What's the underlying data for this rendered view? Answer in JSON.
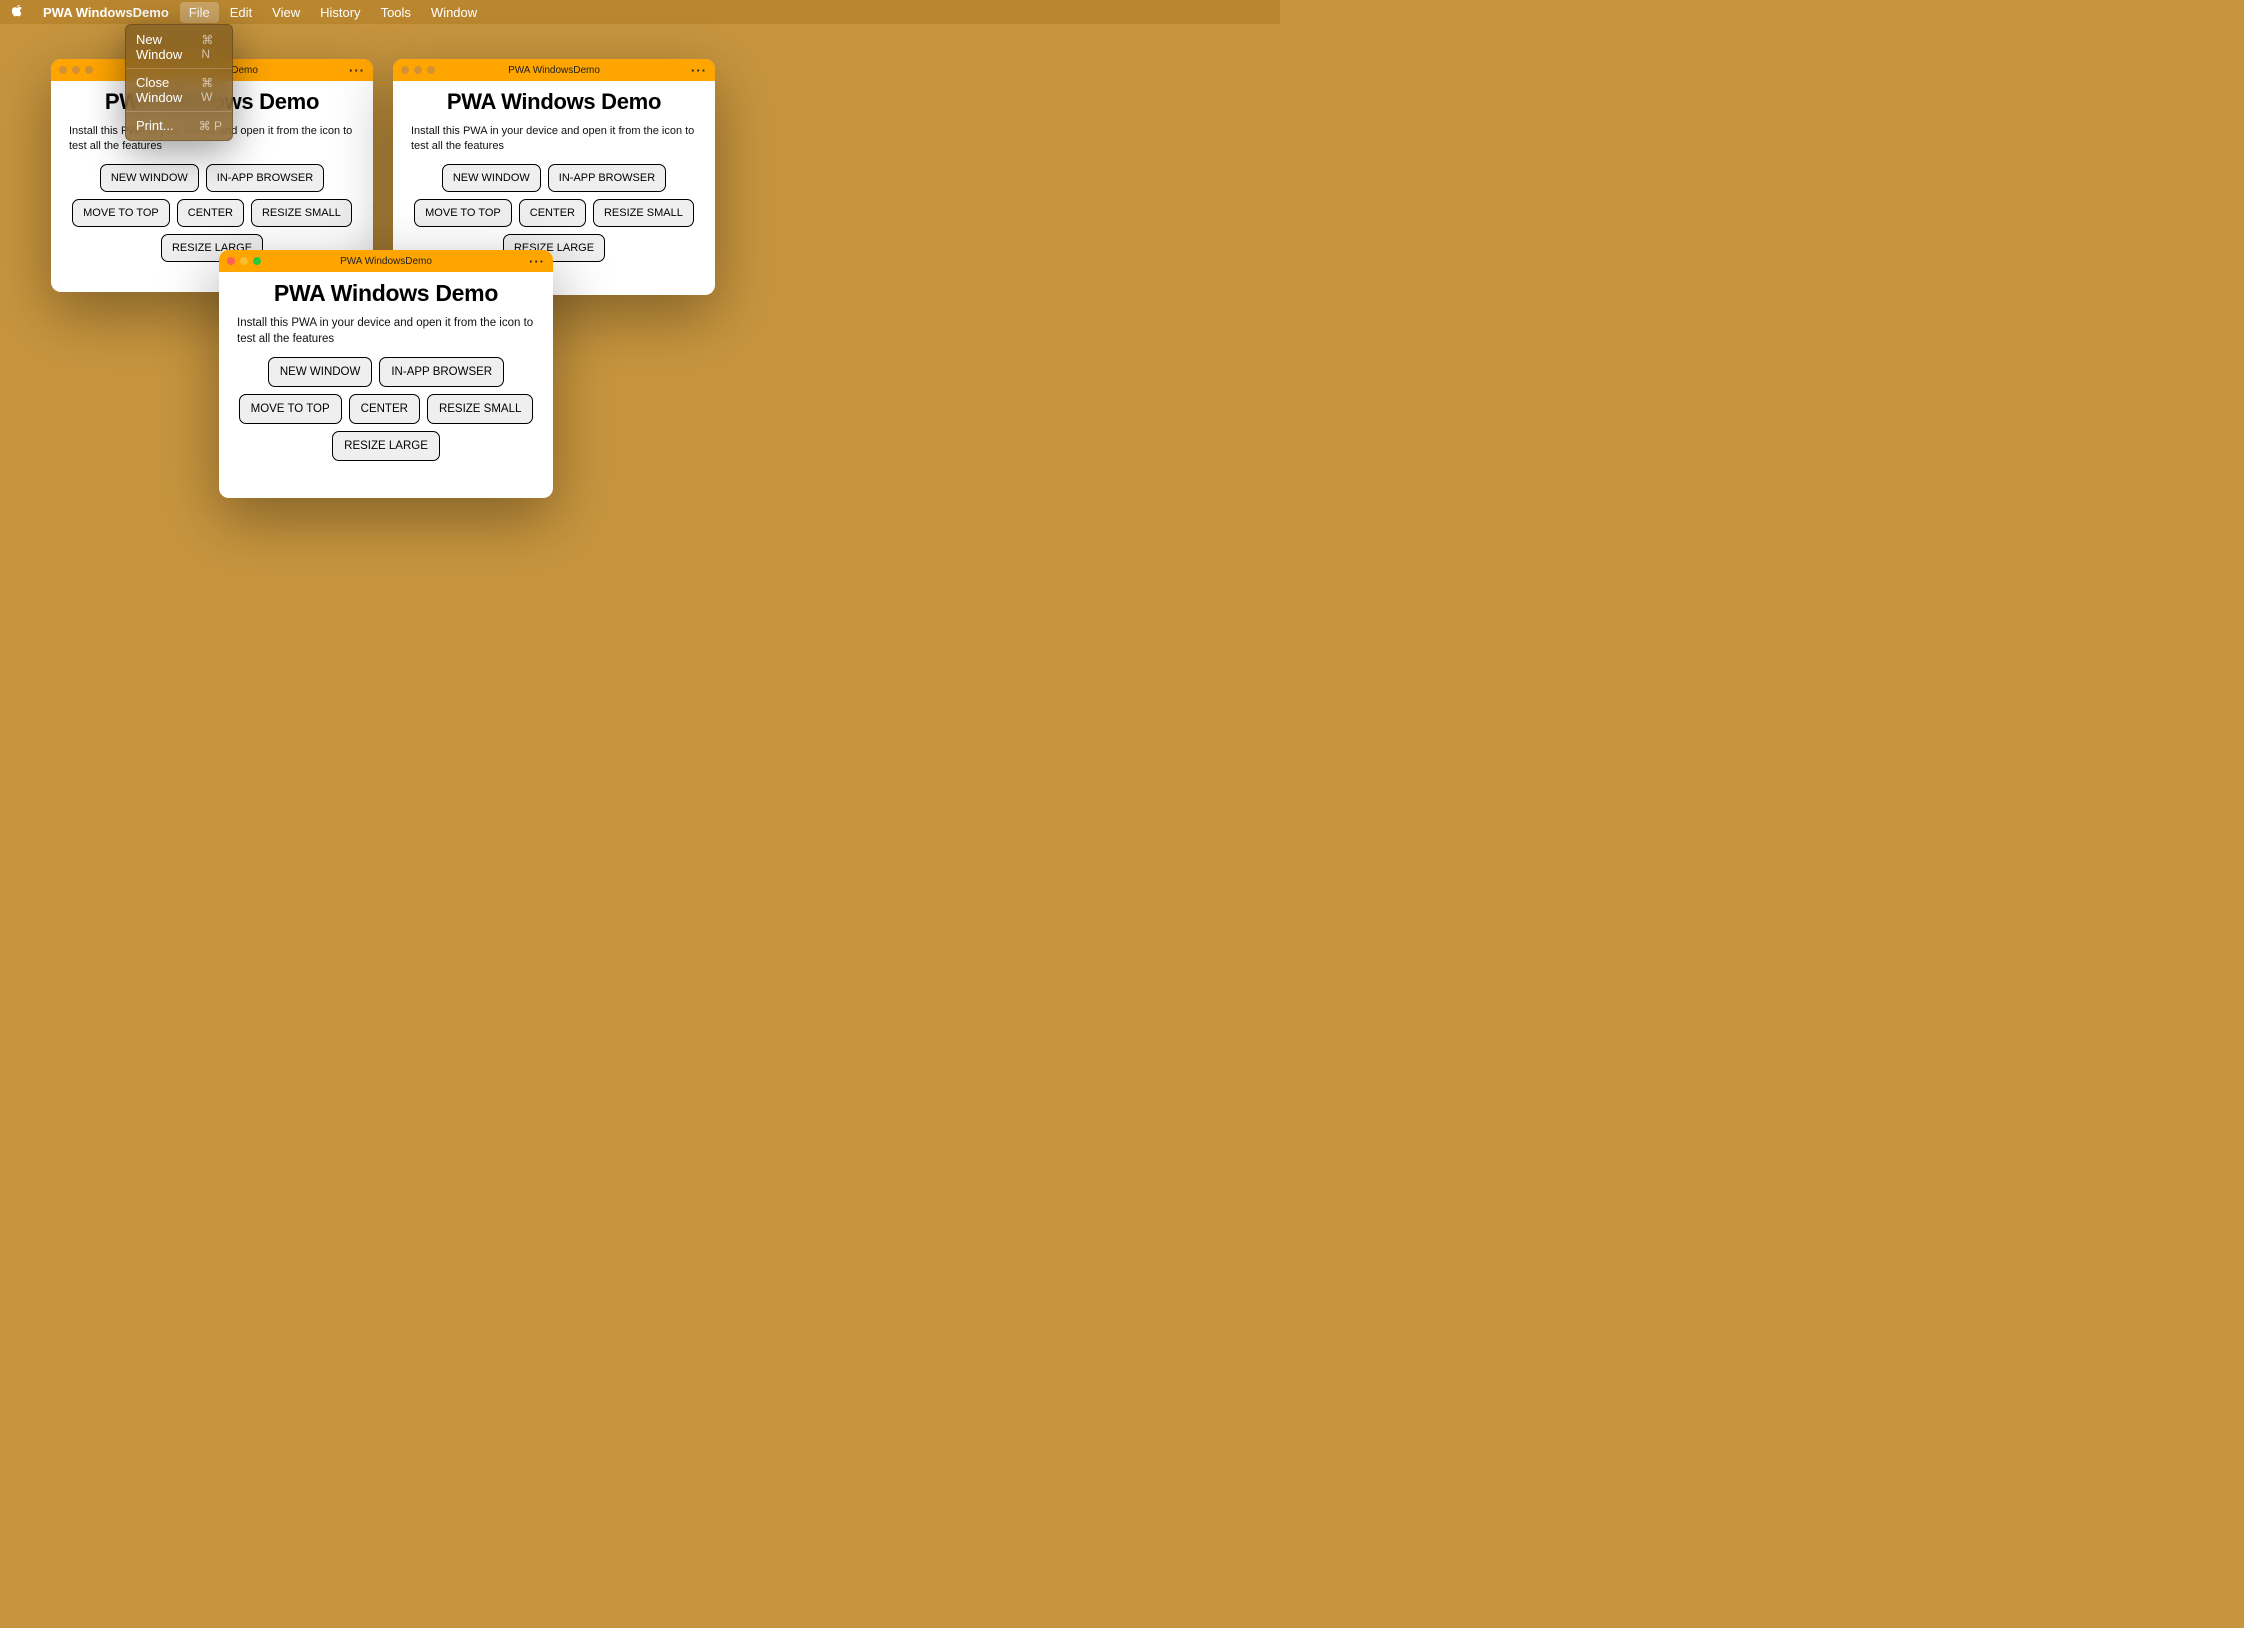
{
  "menubar": {
    "app_name": "PWA WindowsDemo",
    "items": [
      {
        "label": "File",
        "active": true
      },
      {
        "label": "Edit",
        "active": false
      },
      {
        "label": "View",
        "active": false
      },
      {
        "label": "History",
        "active": false
      },
      {
        "label": "Tools",
        "active": false
      },
      {
        "label": "Window",
        "active": false
      }
    ]
  },
  "dropdown": {
    "items": [
      {
        "label": "New Window",
        "shortcut": "⌘ N"
      },
      {
        "label": "Close Window",
        "shortcut": "⌘ W"
      },
      {
        "label": "Print...",
        "shortcut": "⌘ P"
      }
    ]
  },
  "pwa": {
    "window_title": "PWA WindowsDemo",
    "more_dots": "···",
    "heading": "PWA Windows Demo",
    "description": "Install this PWA in your device and open it from the icon to test all the features",
    "buttons": [
      "NEW WINDOW",
      "IN-APP BROWSER",
      "MOVE TO TOP",
      "CENTER",
      "RESIZE SMALL",
      "RESIZE LARGE"
    ]
  }
}
